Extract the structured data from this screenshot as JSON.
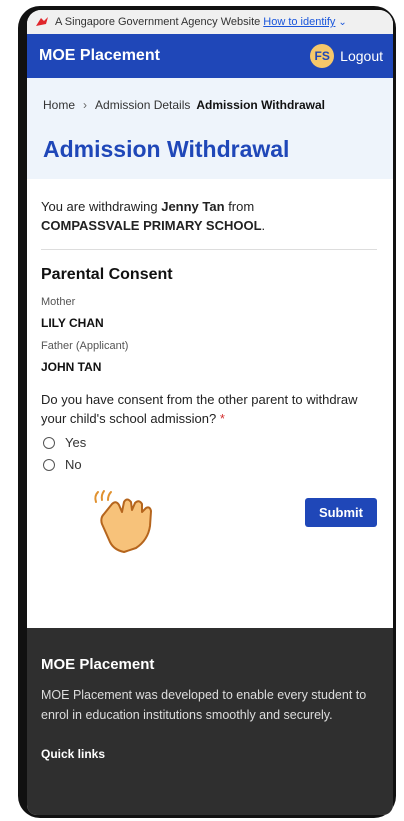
{
  "gov_banner": {
    "text": "A Singapore Government Agency Website",
    "link": "How to identify"
  },
  "appbar": {
    "title": "MOE Placement",
    "avatar_initials": "FS",
    "logout": "Logout"
  },
  "breadcrumb": {
    "home": "Home",
    "parent": "Admission Details",
    "current": "Admission Withdrawal"
  },
  "page": {
    "title": "Admission Withdrawal",
    "intro_prefix": "You are withdrawing",
    "child_name": "Jenny Tan",
    "intro_mid": "from",
    "school": "COMPASSVALE PRIMARY SCHOOL",
    "intro_end": "."
  },
  "consent": {
    "section_title": "Parental Consent",
    "mother_label": "Mother",
    "mother_name": "LILY CHAN",
    "father_label": "Father (Applicant)",
    "father_name": "JOHN TAN",
    "question": "Do you have consent from the other parent to withdraw your child's school admission?",
    "required_mark": "*",
    "options": [
      "Yes",
      "No"
    ]
  },
  "actions": {
    "submit": "Submit"
  },
  "footer": {
    "title": "MOE Placement",
    "description": "MOE Placement was developed to enable every student to enrol in education institutions smoothly and securely.",
    "quick_links": "Quick links"
  },
  "colors": {
    "brand_blue": "#1f47b8",
    "hero_bg": "#eef4fb",
    "footer_bg": "#2f2f2f",
    "avatar_bg": "#f6c86a",
    "required": "#d32f2f"
  }
}
